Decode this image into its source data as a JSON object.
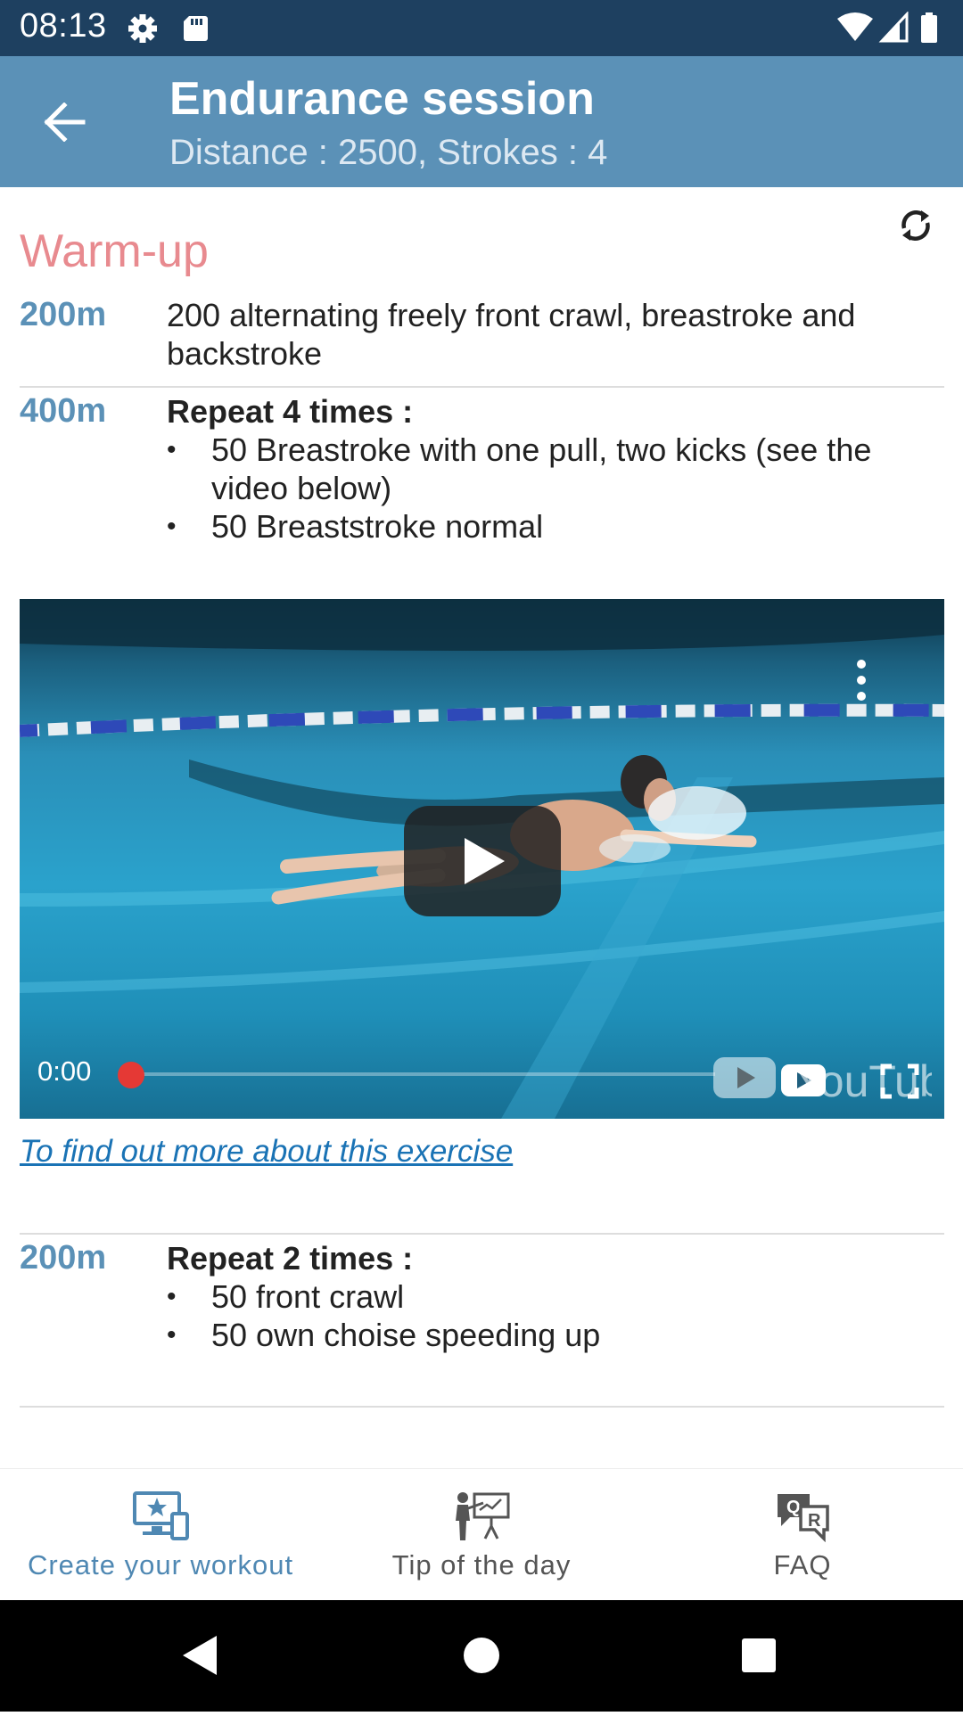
{
  "status_bar": {
    "time": "08:13",
    "left_icons": [
      "gear-icon",
      "sd-card-icon"
    ],
    "right_icons": [
      "wifi-icon",
      "signal-icon",
      "battery-icon"
    ]
  },
  "app_bar": {
    "title": "Endurance session",
    "subtitle": "Distance : 2500, Strokes : 4",
    "background": "#5b91b7"
  },
  "section": {
    "title": "Warm-up",
    "title_color": "#e88a8f"
  },
  "rows": [
    {
      "distance": "200m",
      "text": "200 alternating freely front crawl, breastroke and backstroke"
    },
    {
      "distance": "400m",
      "heading": "Repeat 4 times :",
      "bullets": [
        "50 Breastroke with one pull, two kicks  (see the video below)",
        "50 Breaststroke normal"
      ]
    },
    {
      "distance": "200m",
      "heading": "Repeat 2 times :",
      "bullets": [
        "50 front crawl",
        "50 own choise speeding up"
      ]
    }
  ],
  "video": {
    "time": "0:00",
    "progress": 0,
    "brand": "YouTube",
    "progress_color": "#e53935"
  },
  "more_link": "To find out more about this exercise",
  "bottom_nav": [
    {
      "label": "Create your workout",
      "icon": "workout-screen-icon",
      "active": true
    },
    {
      "label": "Tip of the day",
      "icon": "presentation-icon",
      "active": false
    },
    {
      "label": "FAQ",
      "icon": "faq-chat-icon",
      "active": false
    }
  ],
  "system_nav": [
    "back-icon",
    "home-icon",
    "recents-icon"
  ]
}
